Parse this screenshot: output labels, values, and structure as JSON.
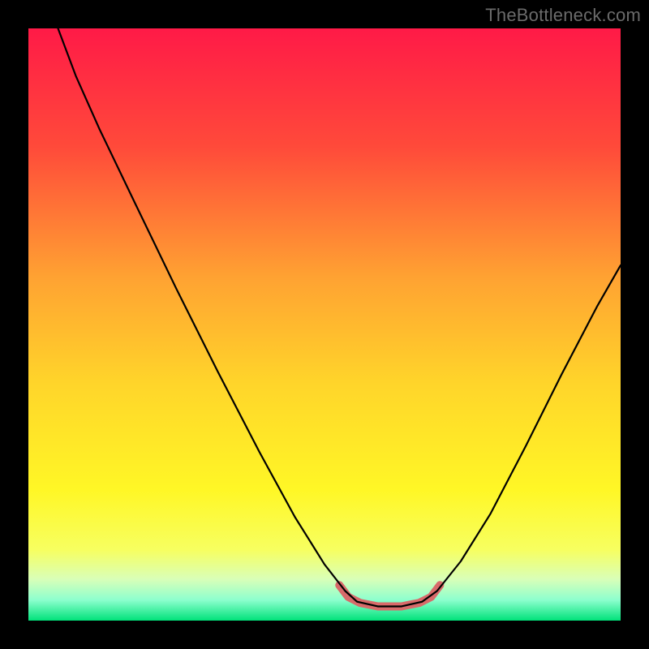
{
  "watermark": "TheBottleneck.com",
  "chart_data": {
    "type": "line",
    "title": "",
    "xlabel": "",
    "ylabel": "",
    "xlim": [
      0,
      100
    ],
    "ylim": [
      0,
      100
    ],
    "gradient_stops": [
      {
        "offset": 0.0,
        "color": "#ff1a47"
      },
      {
        "offset": 0.2,
        "color": "#ff4a3a"
      },
      {
        "offset": 0.42,
        "color": "#ffa232"
      },
      {
        "offset": 0.6,
        "color": "#ffd52a"
      },
      {
        "offset": 0.78,
        "color": "#fff726"
      },
      {
        "offset": 0.88,
        "color": "#f7ff60"
      },
      {
        "offset": 0.93,
        "color": "#d9ffb8"
      },
      {
        "offset": 0.965,
        "color": "#8dffce"
      },
      {
        "offset": 1.0,
        "color": "#00e27a"
      }
    ],
    "series": [
      {
        "name": "bottleneck-curve",
        "stroke": "#000000",
        "stroke_width": 2.2,
        "points": [
          {
            "x": 5.0,
            "y": 100.0
          },
          {
            "x": 8.0,
            "y": 92.0
          },
          {
            "x": 12.0,
            "y": 83.0
          },
          {
            "x": 18.0,
            "y": 70.5
          },
          {
            "x": 25.0,
            "y": 56.0
          },
          {
            "x": 32.0,
            "y": 42.0
          },
          {
            "x": 39.0,
            "y": 28.5
          },
          {
            "x": 45.0,
            "y": 17.5
          },
          {
            "x": 50.0,
            "y": 9.5
          },
          {
            "x": 53.5,
            "y": 5.0
          },
          {
            "x": 55.5,
            "y": 3.2
          },
          {
            "x": 59.0,
            "y": 2.4
          },
          {
            "x": 63.0,
            "y": 2.4
          },
          {
            "x": 66.5,
            "y": 3.2
          },
          {
            "x": 69.0,
            "y": 5.0
          },
          {
            "x": 73.0,
            "y": 10.0
          },
          {
            "x": 78.0,
            "y": 18.0
          },
          {
            "x": 84.0,
            "y": 29.5
          },
          {
            "x": 90.0,
            "y": 41.5
          },
          {
            "x": 96.0,
            "y": 53.0
          },
          {
            "x": 100.0,
            "y": 60.0
          }
        ]
      },
      {
        "name": "bottom-highlight",
        "stroke": "#d86a6a",
        "stroke_width": 10,
        "linecap": "round",
        "points": [
          {
            "x": 52.5,
            "y": 6.0
          },
          {
            "x": 54.0,
            "y": 4.0
          },
          {
            "x": 56.0,
            "y": 3.0
          },
          {
            "x": 59.0,
            "y": 2.4
          },
          {
            "x": 63.0,
            "y": 2.4
          },
          {
            "x": 66.0,
            "y": 3.0
          },
          {
            "x": 68.0,
            "y": 4.0
          },
          {
            "x": 69.5,
            "y": 6.0
          }
        ]
      }
    ]
  }
}
